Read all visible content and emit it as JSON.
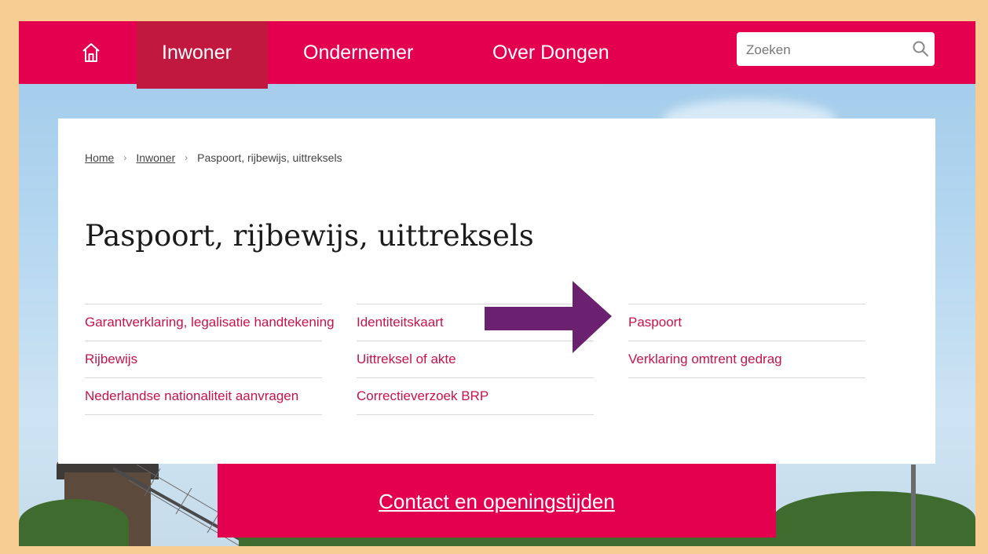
{
  "nav": {
    "home_icon": "home-icon",
    "items": [
      {
        "label": "Inwoner",
        "active": true
      },
      {
        "label": "Ondernemer",
        "active": false
      },
      {
        "label": "Over Dongen",
        "active": false
      }
    ],
    "search": {
      "placeholder": "Zoeken",
      "value": "",
      "icon": "search-icon"
    }
  },
  "breadcrumb": {
    "items": [
      "Home",
      "Inwoner"
    ],
    "current": "Paspoort, rijbewijs, uittreksels"
  },
  "page": {
    "title": "Paspoort, rijbewijs, uittreksels"
  },
  "links": {
    "columns": [
      [
        "Garantverklaring, legalisatie handtekening",
        "Rijbewijs",
        "Nederlandse nationaliteit aanvragen"
      ],
      [
        "Identiteitskaart",
        "Uittreksel of akte",
        "Correctieverzoek BRP"
      ],
      [
        "Paspoort",
        "Verklaring omtrent gedrag"
      ]
    ]
  },
  "contact": {
    "label": "Contact en openingstijden"
  },
  "colors": {
    "brand": "#e3004f",
    "nav_active": "#c0183f",
    "link": "#c5134c",
    "arrow": "#6b2070",
    "frame": "#f7cd94"
  }
}
